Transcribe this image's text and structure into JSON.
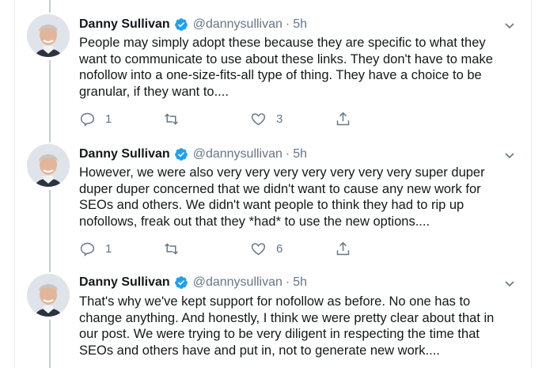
{
  "tweets": [
    {
      "name": "Danny Sullivan",
      "handle": "@dannysullivan",
      "separator": "·",
      "time": "5h",
      "text": "People may simply adopt these because they are specific to what they want to communicate to use about these links. They don't have to make nofollow into a one-size-fits-all type of thing. They have a choice to be granular, if they want to....",
      "replies": "1",
      "retweets": "",
      "likes": "3"
    },
    {
      "name": "Danny Sullivan",
      "handle": "@dannysullivan",
      "separator": "·",
      "time": "5h",
      "text": "However, we were also very very very very very very very super duper duper duper concerned that we didn't want to cause any new work for SEOs and others. We didn't want people to think they had to rip up nofollows, freak out that they *had* to use the new options....",
      "replies": "1",
      "retweets": "",
      "likes": "6"
    },
    {
      "name": "Danny Sullivan",
      "handle": "@dannysullivan",
      "separator": "·",
      "time": "5h",
      "text": "That's why we've kept support for nofollow as before. No one has to change anything. And honestly, I think we were pretty clear about that in our post. We were trying to be very diligent in respecting the time that SEOs and others have and put in, not to generate new work...."
    }
  ],
  "colors": {
    "verified": "#1da1f2",
    "muted": "#657786",
    "thread_line": "#c4cfd6"
  }
}
